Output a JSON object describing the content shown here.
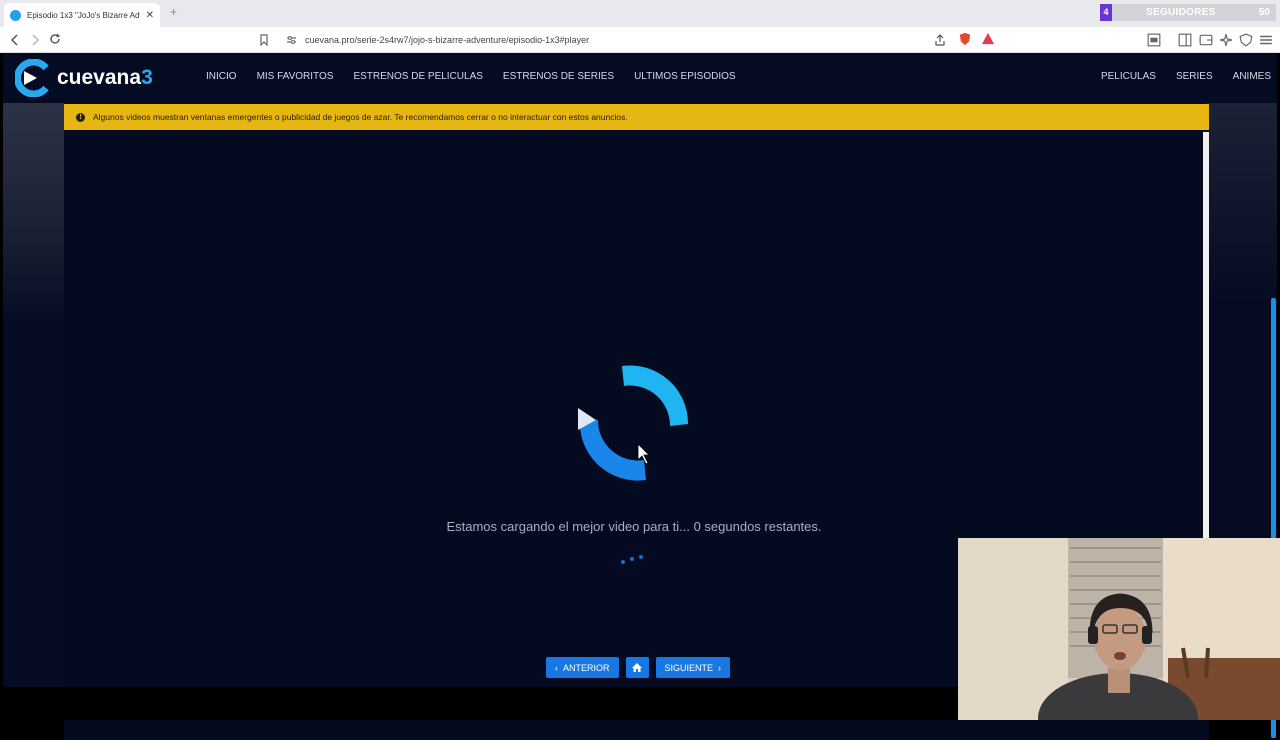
{
  "browser": {
    "tab_title": "Episodio 1x3 \"JoJo's Bizarre Adve",
    "tab_close": "✕",
    "new_tab": "+",
    "url": "cuevana.pro/serie-2s4rw7/jojo-s-bizarre-adventure/episodio-1x3#player"
  },
  "stream_overlay": {
    "badge_number": "4",
    "label": "SEGUIDORES",
    "count": "50"
  },
  "site": {
    "logo_text": "cuevana",
    "logo_number": "3",
    "nav": [
      "INICIO",
      "MIS FAVORITOS",
      "ESTRENOS DE PELICULAS",
      "ESTRENOS DE SERIES",
      "ULTIMOS EPISODIOS"
    ],
    "right_nav": [
      "PELICULAS",
      "SERIES",
      "ANIMES"
    ]
  },
  "warning": {
    "text": "Algunos videos muestran ventanas emergentes o publicidad de juegos de azar. Te recomendamos cerrar o no interactuar con estos anuncios."
  },
  "player": {
    "loading_text": "Estamos cargando el mejor video para ti... 0 segundos restantes."
  },
  "buttons": {
    "prev": "ANTERIOR",
    "next": "SIGUIENTE"
  },
  "icons": {
    "back": "back-arrow-icon",
    "forward": "forward-arrow-icon",
    "reload": "reload-icon",
    "home": "home-icon",
    "warning": "info-icon"
  },
  "colors": {
    "page_bg": "#050b22",
    "accent": "#1877e0",
    "warning_bg": "#e6b712",
    "logo_blue": "#29a9f0"
  }
}
